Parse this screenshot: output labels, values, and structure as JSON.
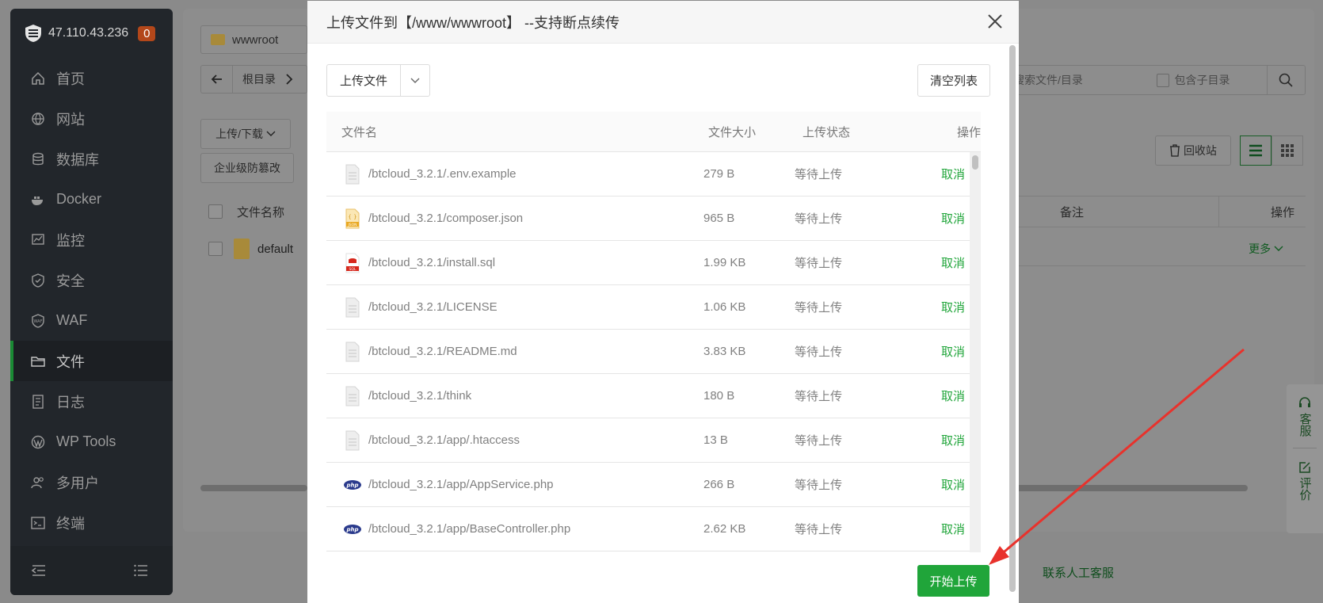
{
  "sidebar": {
    "ip": "47.110.43.236",
    "badge": "0",
    "items": [
      {
        "label": "首页",
        "icon": "home-icon"
      },
      {
        "label": "网站",
        "icon": "globe-icon"
      },
      {
        "label": "数据库",
        "icon": "database-icon"
      },
      {
        "label": "Docker",
        "icon": "docker-icon"
      },
      {
        "label": "监控",
        "icon": "monitor-icon"
      },
      {
        "label": "安全",
        "icon": "shield-icon"
      },
      {
        "label": "WAF",
        "icon": "waf-icon"
      },
      {
        "label": "文件",
        "icon": "folder-icon",
        "active": true
      },
      {
        "label": "日志",
        "icon": "log-icon"
      },
      {
        "label": "WP Tools",
        "icon": "wordpress-icon"
      },
      {
        "label": "多用户",
        "icon": "users-icon"
      },
      {
        "label": "终端",
        "icon": "terminal-icon"
      }
    ]
  },
  "background": {
    "path_tab": "wwwroot",
    "breadcrumb_root": "根目录",
    "upload_download": "上传/下载",
    "firewall": "企业级防篡改",
    "col_filename": "文件名称",
    "row_name": "default",
    "search_placeholder": "搜索文件/目录",
    "include_subdir": "包含子目录",
    "recycle_bin": "回收站",
    "col_remark": "备注",
    "col_op": "操作",
    "more": "更多",
    "contact": "联系人工客服",
    "side_service": "客服",
    "side_review": "评价"
  },
  "modal": {
    "title": "上传文件到【/www/wwwroot】 --支持断点续传",
    "upload_file": "上传文件",
    "clear_list": "清空列表",
    "columns": {
      "name": "文件名",
      "size": "文件大小",
      "status": "上传状态",
      "op": "操作"
    },
    "files": [
      {
        "name": "/btcloud_3.2.1/.env.example",
        "size": "279 B",
        "status": "等待上传",
        "op": "取消",
        "icon": "file-icon"
      },
      {
        "name": "/btcloud_3.2.1/composer.json",
        "size": "965 B",
        "status": "等待上传",
        "op": "取消",
        "icon": "json-file-icon"
      },
      {
        "name": "/btcloud_3.2.1/install.sql",
        "size": "1.99 KB",
        "status": "等待上传",
        "op": "取消",
        "icon": "sql-file-icon"
      },
      {
        "name": "/btcloud_3.2.1/LICENSE",
        "size": "1.06 KB",
        "status": "等待上传",
        "op": "取消",
        "icon": "file-icon"
      },
      {
        "name": "/btcloud_3.2.1/README.md",
        "size": "3.83 KB",
        "status": "等待上传",
        "op": "取消",
        "icon": "file-icon"
      },
      {
        "name": "/btcloud_3.2.1/think",
        "size": "180 B",
        "status": "等待上传",
        "op": "取消",
        "icon": "file-icon"
      },
      {
        "name": "/btcloud_3.2.1/app/.htaccess",
        "size": "13 B",
        "status": "等待上传",
        "op": "取消",
        "icon": "file-icon"
      },
      {
        "name": "/btcloud_3.2.1/app/AppService.php",
        "size": "266 B",
        "status": "等待上传",
        "op": "取消",
        "icon": "php-file-icon"
      },
      {
        "name": "/btcloud_3.2.1/app/BaseController.php",
        "size": "2.62 KB",
        "status": "等待上传",
        "op": "取消",
        "icon": "php-file-icon"
      }
    ],
    "start_upload": "开始上传"
  },
  "colors": {
    "accent": "#20a53a",
    "arrow": "#e8322c"
  }
}
